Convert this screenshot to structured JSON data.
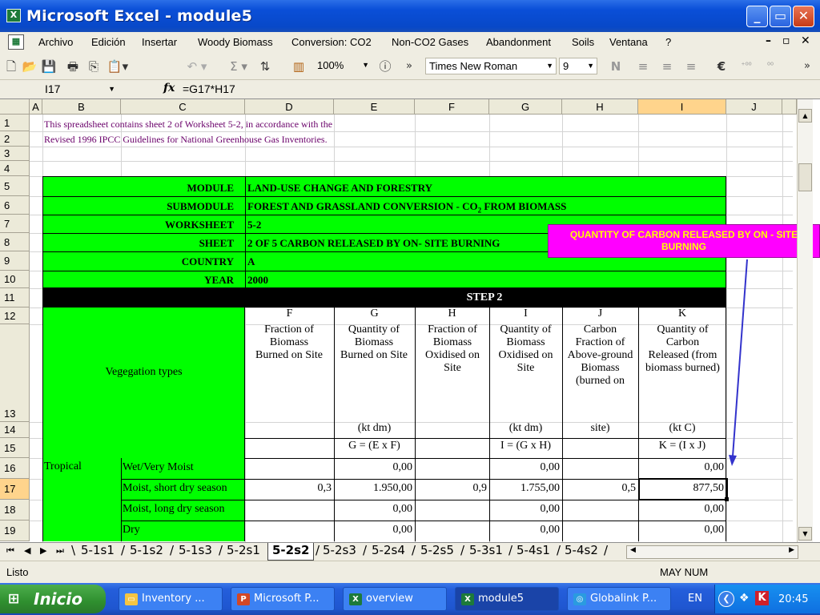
{
  "window": {
    "title": "Microsoft Excel - module5",
    "app_icon_glyph": "X"
  },
  "menu": [
    "Archivo",
    "Edición",
    "Insertar",
    "Woody Biomass",
    "Conversion: CO2",
    "Non-CO2 Gases",
    "Abandonment",
    "Soils",
    "Ventana",
    "?"
  ],
  "toolbar": {
    "zoom": "100%",
    "font_name": "Times New Roman",
    "font_size": "9"
  },
  "formula_bar": {
    "cell_ref": "I17",
    "formula": "=G17*H17"
  },
  "columns": [
    "A",
    "B",
    "C",
    "D",
    "E",
    "F",
    "G",
    "H",
    "I",
    "J"
  ],
  "rows": [
    "1",
    "2",
    "3",
    "4",
    "5",
    "6",
    "7",
    "8",
    "9",
    "10",
    "11",
    "12",
    "13",
    "14",
    "15",
    "16",
    "17",
    "18",
    "19"
  ],
  "sheet": {
    "note_line1": "This spreadsheet contains sheet 2 of Worksheet 5-2, in accordance with the",
    "note_line2": "Revised 1996 IPCC Guidelines for National Greenhouse Gas Inventories.",
    "info": [
      {
        "label": "MODULE",
        "value": "LAND-USE CHANGE AND FORESTRY"
      },
      {
        "label": "SUBMODULE",
        "value": "FOREST AND GRASSLAND CONVERSION - CO",
        "value_sub": "2",
        "value_tail": " FROM BIOMASS"
      },
      {
        "label": "WORKSHEET",
        "value": "5-2"
      },
      {
        "label": "SHEET",
        "value": "2 OF 5  CARBON RELEASED BY  ON- SITE BURNING"
      },
      {
        "label": "COUNTRY",
        "value": "A"
      },
      {
        "label": "YEAR",
        "value": "2000"
      }
    ],
    "step": "STEP 2",
    "vegetation_label": "Vegegation types",
    "col_letters": [
      "F",
      "G",
      "H",
      "I",
      "J",
      "K"
    ],
    "col_headers": [
      "Fraction of Biomass Burned on Site",
      "Quantity of Biomass Burned on Site",
      "Fraction of Biomass Oxidised on Site",
      "Quantity of Biomass Oxidised on Site",
      "Carbon Fraction of Above-ground Biomass (burned on",
      "Quantity of Carbon Released (from biomass burned)"
    ],
    "units": [
      "",
      "(kt dm)",
      "",
      "(kt dm)",
      "site)",
      "(kt C)"
    ],
    "formulas": [
      "",
      "G = (E x F)",
      "",
      "I = (G x H)",
      "",
      "K = (I x J)"
    ],
    "region": "Tropical",
    "data_rows": [
      {
        "type": "Wet/Very Moist",
        "values": [
          "",
          "0,00",
          "",
          "0,00",
          "",
          "0,00"
        ]
      },
      {
        "type": "Moist, short dry season",
        "values": [
          "0,3",
          "1.950,00",
          "0,9",
          "1.755,00",
          "0,5",
          "877,50"
        ]
      },
      {
        "type": "Moist, long dry season",
        "values": [
          "",
          "0,00",
          "",
          "0,00",
          "",
          "0,00"
        ]
      },
      {
        "type": "Dry",
        "values": [
          "",
          "0,00",
          "",
          "0,00",
          "",
          "0,00"
        ]
      }
    ],
    "callout": "QUANTITY OF CARBON RELEASED BY ON - SITE BURNING"
  },
  "sheet_tabs": [
    "5-1s1",
    "5-1s2",
    "5-1s3",
    "5-2s1",
    "5-2s2",
    "5-2s3",
    "5-2s4",
    "5-2s5",
    "5-3s1",
    "5-4s1",
    "5-4s2"
  ],
  "active_tab": "5-2s2",
  "status": {
    "left": "Listo",
    "right": "MAY NUM"
  },
  "taskbar": {
    "start": "Inicio",
    "tasks": [
      "Inventory ...",
      "Microsoft P...",
      "overview",
      "module5",
      "Globalink P..."
    ],
    "lang": "EN",
    "clock": "20:45"
  },
  "colors": {
    "green": "#00ff00",
    "magenta": "#ff00ff",
    "callout_text": "#ffff00",
    "arrow": "#3333cc",
    "selection": "#ffd48c"
  }
}
